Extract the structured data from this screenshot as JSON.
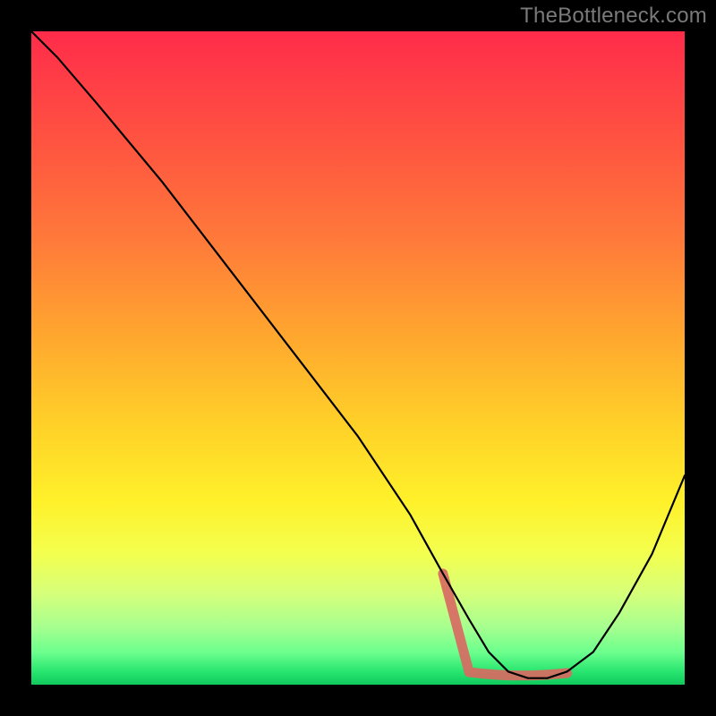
{
  "watermark": "TheBottleneck.com",
  "chart_data": {
    "type": "line",
    "title": "",
    "xlabel": "",
    "ylabel": "",
    "xlim": [
      0,
      100
    ],
    "ylim": [
      0,
      100
    ],
    "grid": false,
    "legend": false,
    "background_gradient": {
      "direction": "vertical",
      "stops": [
        {
          "pos": 0,
          "color": "#ff2b4a"
        },
        {
          "pos": 18,
          "color": "#ff5640"
        },
        {
          "pos": 46,
          "color": "#ffa52f"
        },
        {
          "pos": 72,
          "color": "#fff12a"
        },
        {
          "pos": 91,
          "color": "#a8ff8f"
        },
        {
          "pos": 100,
          "color": "#0fc95c"
        }
      ]
    },
    "series": [
      {
        "name": "bottleneck-curve",
        "color": "#000000",
        "x": [
          0,
          4,
          10,
          20,
          30,
          40,
          50,
          58,
          63,
          67,
          70,
          73,
          76,
          79,
          82,
          86,
          90,
          95,
          100
        ],
        "y": [
          100,
          96,
          89,
          77,
          64,
          51,
          38,
          26,
          17,
          10,
          5,
          2,
          1,
          1,
          2,
          5,
          11,
          20,
          32
        ]
      }
    ],
    "highlight": {
      "name": "optimal-range",
      "color": "#d86a63",
      "x": [
        63,
        67,
        70,
        73,
        76,
        79,
        82
      ],
      "y": [
        17,
        10,
        5,
        2,
        1,
        1,
        2
      ],
      "flat_segment": {
        "x_start": 67,
        "x_end": 82,
        "y": 1.5
      }
    }
  }
}
